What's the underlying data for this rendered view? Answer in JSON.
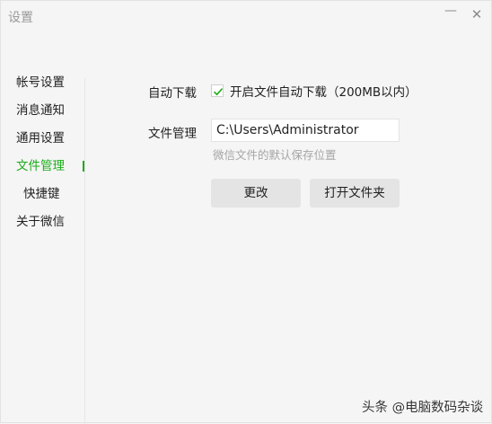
{
  "window": {
    "title": "设置",
    "minimize_glyph": "—",
    "close_glyph": "✕",
    "accent_color": "#1aad19"
  },
  "sidebar": {
    "items": [
      {
        "label": "帐号设置"
      },
      {
        "label": "消息通知"
      },
      {
        "label": "通用设置"
      },
      {
        "label": "文件管理",
        "active": true
      },
      {
        "label": "快捷键"
      },
      {
        "label": "关于微信"
      }
    ]
  },
  "file_settings": {
    "auto_download_label": "自动下载",
    "auto_download_checked": true,
    "auto_download_option": "开启文件自动下载（200MB以内）",
    "file_manage_label": "文件管理",
    "path_value": "C:\\Users\\Administrator",
    "path_hint": "微信文件的默认保存位置",
    "change_button": "更改",
    "open_folder_button": "打开文件夹"
  },
  "watermark": {
    "text": "头条 @电脑数码杂谈"
  }
}
